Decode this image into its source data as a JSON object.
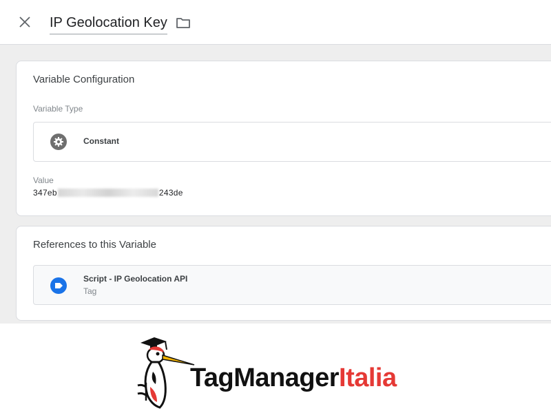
{
  "header": {
    "title": "IP Geolocation Key",
    "close_icon": "close-icon",
    "folder_icon": "folder-icon"
  },
  "variable_configuration": {
    "title": "Variable Configuration",
    "type_label": "Variable Type",
    "type_name": "Constant",
    "type_icon": "gear-icon",
    "value_label": "Value",
    "value_prefix": "347eb",
    "value_suffix": "243de",
    "value_hidden": true
  },
  "references": {
    "title": "References to this Variable",
    "items": [
      {
        "name": "Script - IP Geolocation API",
        "kind": "Tag",
        "icon": "tag-icon"
      }
    ]
  },
  "branding": {
    "part1": "TagManager",
    "part2": "Italia",
    "colors": {
      "part1": "#111111",
      "part2": "#e53935"
    },
    "mascot_icon": "woodpecker-mascot-icon"
  },
  "colors": {
    "tag_icon": "#1a73e8",
    "type_icon": "#6f6f6f",
    "background": "#eeeeee"
  }
}
